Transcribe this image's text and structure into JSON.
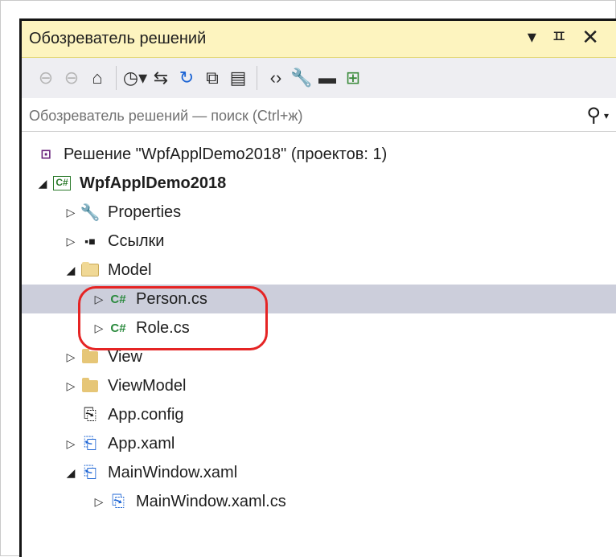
{
  "panel": {
    "title": "Обозреватель решений",
    "buttons": [
      "▾",
      "ㅍ",
      "✕"
    ]
  },
  "toolbar": {
    "icons": [
      "back-icon",
      "forward-icon",
      "home-icon",
      "history-icon",
      "sync-icon",
      "refresh-icon",
      "collapse-all-icon",
      "show-all-files-icon",
      "view-code-icon",
      "properties-icon",
      "preview-icon",
      "view-class-diagram-icon"
    ]
  },
  "search": {
    "placeholder": "Обозреватель решений — поиск (Ctrl+ж)"
  },
  "tree": {
    "solution": "Решение \"WpfApplDemo2018\"  (проектов: 1)",
    "project": "WpfApplDemo2018",
    "properties": "Properties",
    "references": "Ссылки",
    "model": "Model",
    "person": "Person.cs",
    "role": "Role.cs",
    "view": "View",
    "viewmodel": "ViewModel",
    "appconfig": "App.config",
    "appxaml": "App.xaml",
    "mainwindow": "MainWindow.xaml",
    "mainwindowcs": "MainWindow.xaml.cs",
    "cs_badge": "C#",
    "cs_small": "C#"
  },
  "colors": {
    "title_bg": "#fdf4bf",
    "selection": "#cccedb",
    "annotation": "#e52424"
  }
}
